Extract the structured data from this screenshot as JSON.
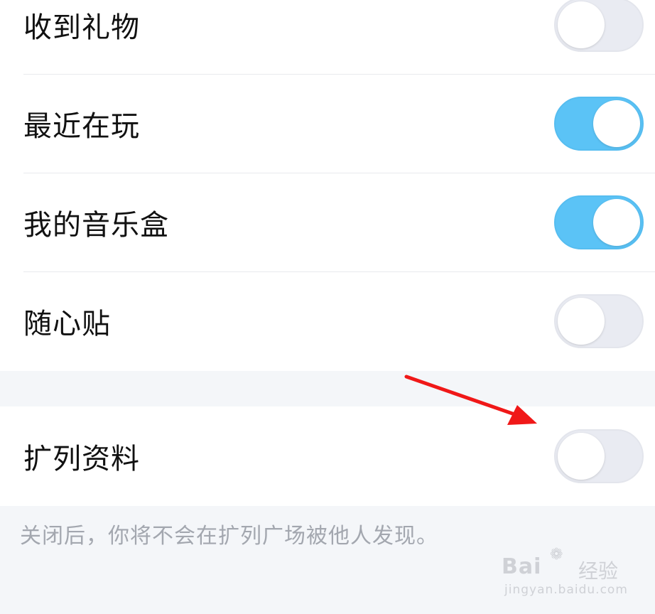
{
  "settings_group_1": {
    "rows": [
      {
        "label": "收到礼物",
        "toggle_state": "off"
      },
      {
        "label": "最近在玩",
        "toggle_state": "on"
      },
      {
        "label": "我的音乐盒",
        "toggle_state": "on"
      },
      {
        "label": "随心贴",
        "toggle_state": "off"
      }
    ]
  },
  "settings_group_2": {
    "rows": [
      {
        "label": "扩列资料",
        "toggle_state": "off"
      }
    ],
    "hint": "关闭后，你将不会在扩列广场被他人发现。"
  },
  "annotation": {
    "arrow_color": "#f01818",
    "icon": "red-arrow-icon"
  },
  "colors": {
    "toggle_on": "#5bc3f6",
    "toggle_off": "#e9ebf2",
    "page_background": "#f4f6f9"
  },
  "watermark": {
    "brand": "Bai",
    "brand_suffix": "经验",
    "url": "jingyan.baidu.com",
    "icon": "baidu-paw-icon"
  }
}
